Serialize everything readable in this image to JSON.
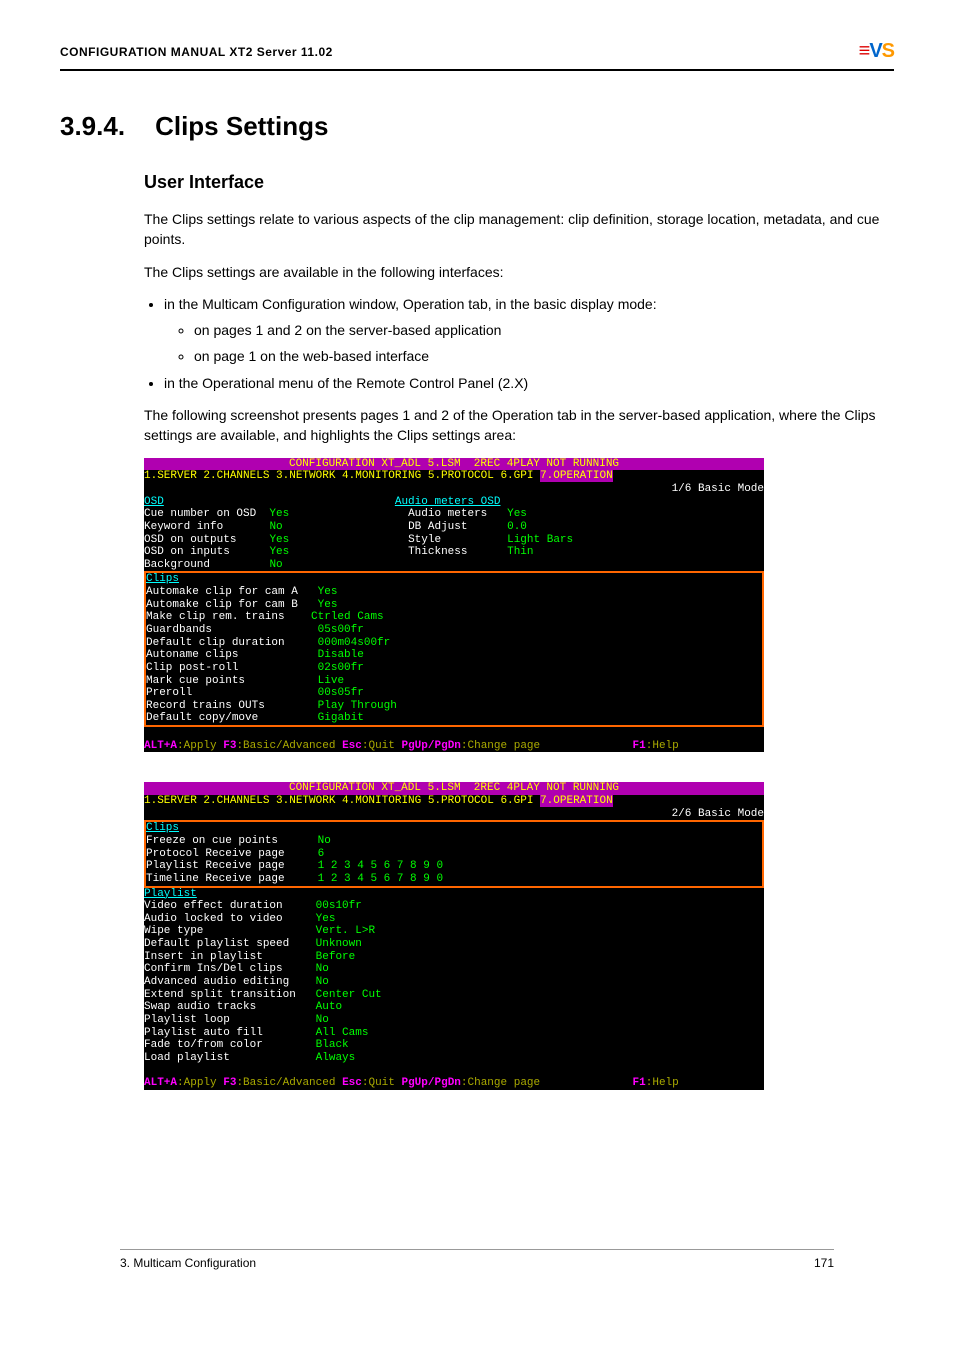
{
  "header": {
    "title": "CONFIGURATION MANUAL  XT2 Server 11.02"
  },
  "section": {
    "number": "3.9.4.",
    "title": "Clips Settings",
    "subheading": "User Interface",
    "para1": "The Clips settings relate to various aspects of the clip management: clip definition, storage location, metadata, and cue points.",
    "para2": "The Clips settings are available in the following interfaces:",
    "bullet1": "in the Multicam Configuration window, Operation tab, in the basic display mode:",
    "sub1": "on pages 1 and 2 on the server-based application",
    "sub2": "on page 1 on the web-based interface",
    "bullet2": "in the Operational menu of the Remote Control Panel (2.X)",
    "para3": "The following screenshot presents pages 1 and 2 of the Operation tab in the server-based application, where the Clips settings are available, and highlights the Clips settings area:"
  },
  "term1": {
    "title": "CONFIGURATION XT_ADL 5.LSM  2REC 4PLAY NOT RUNNING",
    "tabs": "1.SERVER 2.CHANNELS 3.NETWORK 4.MONITORING 5.PROTOCOL 6.GPI ",
    "tab7": "7.OPERATION",
    "mode": "1/6 Basic Mode",
    "osd_header": "OSD",
    "osd": [
      {
        "l": "Cue number on OSD",
        "v": "Yes"
      },
      {
        "l": "Keyword info",
        "v": "No"
      },
      {
        "l": "OSD on outputs",
        "v": "Yes"
      },
      {
        "l": "OSD on inputs",
        "v": "Yes"
      },
      {
        "l": "Background",
        "v": "No"
      }
    ],
    "audio_header": "Audio meters OSD",
    "audio": [
      {
        "l": "Audio meters",
        "v": "Yes"
      },
      {
        "l": "DB Adjust",
        "v": "0.0"
      },
      {
        "l": "Style",
        "v": "Light Bars"
      },
      {
        "l": "Thickness",
        "v": "Thin"
      }
    ],
    "clips_header": "Clips",
    "clips": [
      {
        "l": "Automake clip for cam A",
        "v": "Yes"
      },
      {
        "l": "Automake clip for cam B",
        "v": "Yes"
      },
      {
        "l": "Make clip rem. trains",
        "v": "Ctrled Cams"
      },
      {
        "l": "Guardbands",
        "v": "05s00fr"
      },
      {
        "l": "Default clip duration",
        "v": "000m04s00fr"
      },
      {
        "l": "Autoname clips",
        "v": "Disable"
      },
      {
        "l": "Clip post-roll",
        "v": "02s00fr"
      },
      {
        "l": "Mark cue points",
        "v": "Live"
      },
      {
        "l": "Preroll",
        "v": "00s05fr"
      },
      {
        "l": "Record trains OUTs",
        "v": "Play Through"
      },
      {
        "l": "Default copy/move",
        "v": "Gigabit"
      }
    ]
  },
  "term2": {
    "title": "CONFIGURATION XT_ADL 5.LSM  2REC 4PLAY NOT RUNNING",
    "tabs": "1.SERVER 2.CHANNELS 3.NETWORK 4.MONITORING 5.PROTOCOL 6.GPI ",
    "tab7": "7.OPERATION",
    "mode": "2/6 Basic Mode",
    "clips_header": "Clips",
    "clips": [
      {
        "l": "Freeze on cue points",
        "v": "No"
      },
      {
        "l": "Protocol Receive page",
        "v": "6"
      },
      {
        "l": "Playlist Receive page",
        "v": "1 2 3 4 5 6 7 8 9 0"
      },
      {
        "l": "Timeline Receive page",
        "v": "1 2 3 4 5 6 7 8 9 0"
      }
    ],
    "playlist_header": "Playlist",
    "playlist": [
      {
        "l": "Video effect duration",
        "v": "00s10fr"
      },
      {
        "l": "Audio locked to video",
        "v": "Yes"
      },
      {
        "l": "Wipe type",
        "v": "Vert. L>R"
      },
      {
        "l": "Default playlist speed",
        "v": "Unknown"
      },
      {
        "l": "Insert in playlist",
        "v": "Before"
      },
      {
        "l": "Confirm Ins/Del clips",
        "v": "No"
      },
      {
        "l": "Advanced audio editing",
        "v": "No"
      },
      {
        "l": "Extend split transition",
        "v": "Center Cut"
      },
      {
        "l": "Swap audio tracks",
        "v": "Auto"
      },
      {
        "l": "Playlist loop",
        "v": "No"
      },
      {
        "l": "Playlist auto fill",
        "v": "All Cams"
      },
      {
        "l": "Fade to/from color",
        "v": "Black"
      },
      {
        "l": "Load playlist",
        "v": "Always"
      }
    ]
  },
  "footkeys": {
    "alta": "ALT+A",
    "apply": ":Apply ",
    "f3": "F3",
    "basic": ":Basic/Advanced ",
    "esc": "Esc",
    "quit": ":Quit ",
    "pg": "PgUp/PgDn",
    "chg": ":Change page",
    "f1": "F1",
    "help": ":Help"
  },
  "footer": {
    "left": "3. Multicam Configuration",
    "right": "171"
  }
}
